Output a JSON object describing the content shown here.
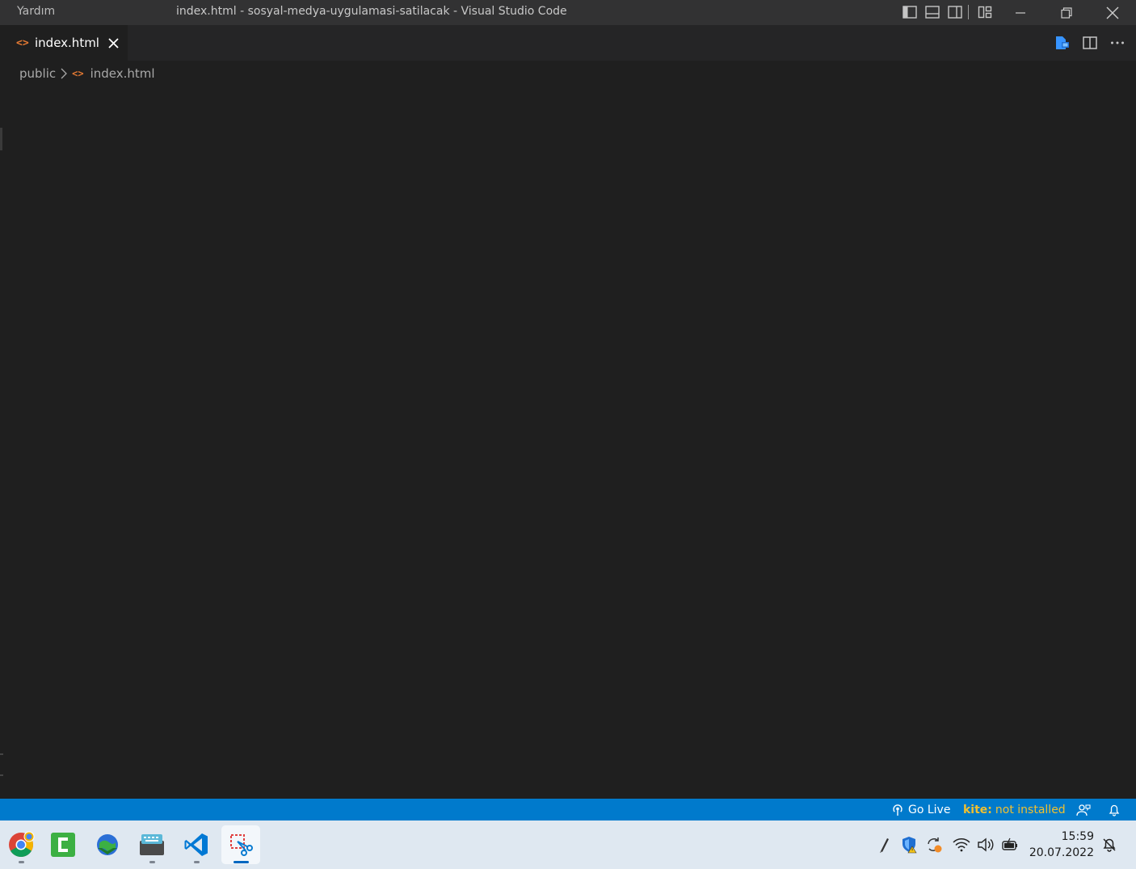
{
  "window": {
    "menu_label": "Yardım",
    "title": "index.html - sosyal-medya-uygulamasi-satilacak - Visual Studio Code"
  },
  "tabs": [
    {
      "label": "index.html",
      "icon": "html-file-icon",
      "active": true
    }
  ],
  "breadcrumb": {
    "folder": "public",
    "file": "index.html"
  },
  "statusbar": {
    "go_live": "Go Live",
    "kite_prefix": "kite:",
    "kite_status": "not installed"
  },
  "taskbar": {
    "apps": [
      "chrome-icon",
      "camtasia-icon",
      "internet-download-manager-icon",
      "keyboard-app-icon",
      "vscode-icon",
      "snipping-tool-icon"
    ],
    "active_app": "snipping-tool-icon",
    "time": "15:59",
    "date": "20.07.2022"
  },
  "colors": {
    "statusbar": "#007acc",
    "editor_bg": "#1f1f1f",
    "titlebar_bg": "#323233",
    "html_icon": "#e37933",
    "kite": "#f0c030"
  }
}
